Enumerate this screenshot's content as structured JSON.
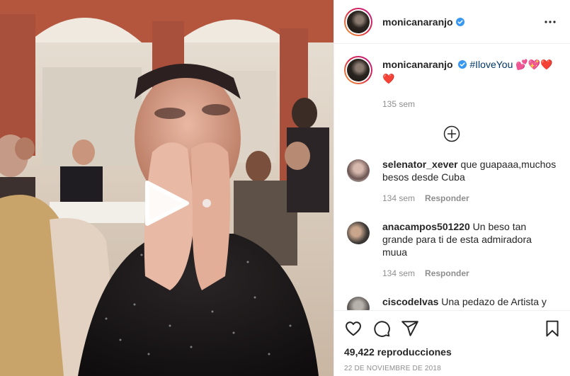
{
  "post": {
    "username": "monicanaranjo",
    "caption_hashtag": "#IloveYou",
    "caption_emoji_row1": "💕💖❤️",
    "caption_emoji_row2": "❤️",
    "caption_time": "135 sem",
    "views_count": "49,422",
    "views_label": "reproducciones",
    "date": "22 DE NOVIEMBRE DE 2018"
  },
  "comments": [
    {
      "username": "selenator_xever",
      "text": "que guapaaa,muchos besos desde Cuba",
      "time": "134 sem",
      "reply_label": "Responder"
    },
    {
      "username": "anacampos501220",
      "text": "Un beso tan grande para ti de esta admiradora muua",
      "time": "134 sem",
      "reply_label": "Responder"
    },
    {
      "username": "ciscodelvas",
      "text": "Una pedazo de Artista y",
      "time": "",
      "reply_label": ""
    }
  ],
  "colors": {
    "verified": "#3897f0",
    "hashtag": "#00376b",
    "muted": "#8e8e8e",
    "text": "#262626"
  },
  "icons": [
    "play-icon",
    "verified-icon",
    "more-icon",
    "plus-circle-icon",
    "heart-icon",
    "comment-icon",
    "share-icon",
    "bookmark-icon"
  ]
}
